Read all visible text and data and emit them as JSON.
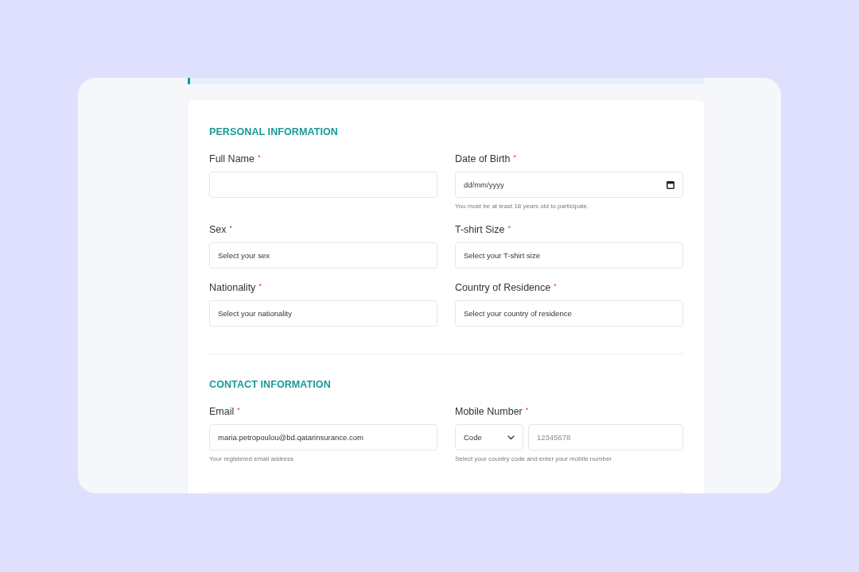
{
  "sections": [
    {
      "title": "PERSONAL INFORMATION",
      "fields": [
        {
          "kind": "text",
          "label": "Full Name",
          "required_mark": "*"
        },
        {
          "kind": "date",
          "label": "Date of Birth",
          "required_mark": "*",
          "placeholder": "dd/mm/yyyy",
          "hint": "You must be at least 18 years old to participate."
        },
        {
          "kind": "select",
          "label": "Sex",
          "required_mark": "*",
          "value": "Select your sex"
        },
        {
          "kind": "select",
          "label": "T-shirt Size",
          "required_mark": "*",
          "value": "Select your T-shirt size"
        },
        {
          "kind": "select",
          "label": "Nationality",
          "required_mark": "*",
          "value": "Select your nationality"
        },
        {
          "kind": "select",
          "label": "Country of Residence",
          "required_mark": "*",
          "value": "Select your country of residence"
        }
      ]
    },
    {
      "title": "CONTACT INFORMATION",
      "fields": [
        {
          "kind": "email",
          "label": "Email",
          "required_mark": "*",
          "value": "maria.petropoulou@bd.qatarinsurance.com",
          "hint": "Your registered email address"
        },
        {
          "kind": "phone",
          "label": "Mobile Number",
          "required_mark": "*",
          "code": {
            "value": "Code"
          },
          "number": {
            "placeholder": "12345678"
          },
          "hint": "Select your country code and enter your mobile number"
        }
      ]
    }
  ]
}
